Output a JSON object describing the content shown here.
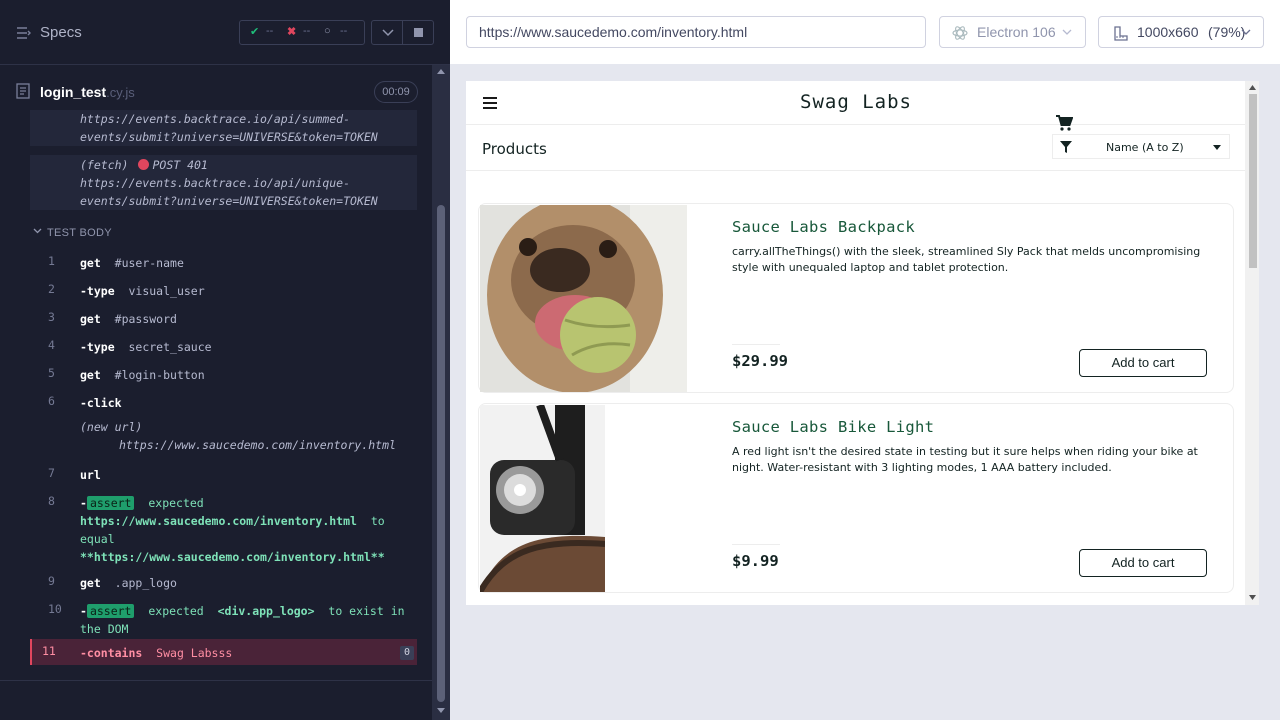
{
  "runner": {
    "specs_title": "Specs",
    "stats": {
      "passed": "--",
      "failed": "--",
      "pending": "--"
    },
    "file_name": "login_test",
    "file_ext": ".cy.js",
    "timer": "00:09",
    "fetch_1": {
      "line1": "https://events.backtrace.io/api/summed-",
      "line2": "events/submit?universe=UNIVERSE&token=TOKEN"
    },
    "fetch_2": {
      "label": "(fetch)",
      "status": "POST 401",
      "line1": "https://events.backtrace.io/api/unique-",
      "line2": "events/submit?universe=UNIVERSE&token=TOKEN"
    },
    "test_body_label": "TEST BODY",
    "commands": [
      {
        "num": "1",
        "name": "get",
        "arg": "#user-name"
      },
      {
        "num": "2",
        "name": "-type",
        "arg": "visual_user"
      },
      {
        "num": "3",
        "name": "get",
        "arg": "#password"
      },
      {
        "num": "4",
        "name": "-type",
        "arg": "secret_sauce"
      },
      {
        "num": "5",
        "name": "get",
        "arg": "#login-button"
      },
      {
        "num": "6",
        "name": "-click",
        "arg": ""
      },
      {
        "num": "",
        "name": "(new url)",
        "arg": "https://www.saucedemo.com/inventory.html"
      },
      {
        "num": "7",
        "name": "url",
        "arg": ""
      },
      {
        "num": "8",
        "name": "-",
        "badge": "assert",
        "text1": "expected",
        "text2": "https://www.saucedemo.com/inventory.html",
        "text3": "to equal",
        "text4": "**https://www.saucedemo.com/inventory.html**"
      },
      {
        "num": "9",
        "name": "get",
        "arg": ".app_logo"
      },
      {
        "num": "10",
        "name": "-",
        "badge": "assert",
        "text1": "expected",
        "text2": "<div.app_logo>",
        "text3": "to exist in the DOM"
      },
      {
        "num": "11",
        "name": "-contains",
        "arg": "Swag Labsss",
        "count": "0"
      }
    ]
  },
  "aut": {
    "url": "https://www.saucedemo.com/inventory.html",
    "browser": "Electron 106",
    "viewport": "1000x660",
    "zoom": "(79%)"
  },
  "app": {
    "logo": "Swag Labs",
    "title": "Products",
    "sort_value": "Name (A to Z)",
    "items": [
      {
        "name": "Sauce Labs Backpack",
        "desc": "carry.allTheThings() with the sleek, streamlined Sly Pack that melds uncompromising style with unequaled laptop and tablet protection.",
        "price": "$29.99",
        "button": "Add to cart"
      },
      {
        "name": "Sauce Labs Bike Light",
        "desc": "A red light isn't the desired state in testing but it sure helps when riding your bike at night. Water-resistant with 3 lighting modes, 1 AAA battery included.",
        "price": "$9.99",
        "button": "Add to cart"
      }
    ]
  },
  "colors": {
    "runner_bg": "#1b1e2e",
    "pass": "#1f9e6c",
    "fail": "#e0465e",
    "app_green": "#18583a"
  }
}
